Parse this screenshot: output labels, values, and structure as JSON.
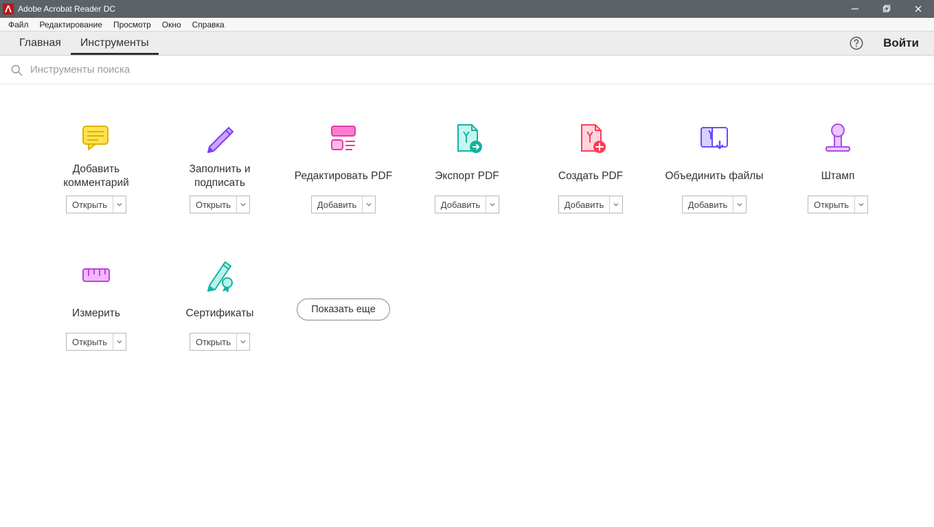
{
  "window": {
    "title": "Adobe Acrobat Reader DC"
  },
  "menu": {
    "items": [
      "Файл",
      "Редактирование",
      "Просмотр",
      "Окно",
      "Справка"
    ]
  },
  "tabs": {
    "home": "Главная",
    "tools": "Инструменты"
  },
  "header": {
    "sign_in": "Войти"
  },
  "search": {
    "placeholder": "Инструменты поиска"
  },
  "actions": {
    "open": "Открыть",
    "add": "Добавить"
  },
  "tools": [
    {
      "id": "comment",
      "label": "Добавить\nкомментарий",
      "action": "open"
    },
    {
      "id": "fill-sign",
      "label": "Заполнить и\nподписать",
      "action": "open"
    },
    {
      "id": "edit-pdf",
      "label": "Редактировать PDF",
      "action": "add"
    },
    {
      "id": "export-pdf",
      "label": "Экспорт PDF",
      "action": "add"
    },
    {
      "id": "create-pdf",
      "label": "Создать PDF",
      "action": "add"
    },
    {
      "id": "combine",
      "label": "Объединить файлы",
      "action": "add"
    },
    {
      "id": "stamp",
      "label": "Штамп",
      "action": "open"
    },
    {
      "id": "measure",
      "label": "Измерить",
      "action": "open"
    },
    {
      "id": "certs",
      "label": "Сертификаты",
      "action": "open"
    }
  ],
  "show_more": "Показать еще"
}
